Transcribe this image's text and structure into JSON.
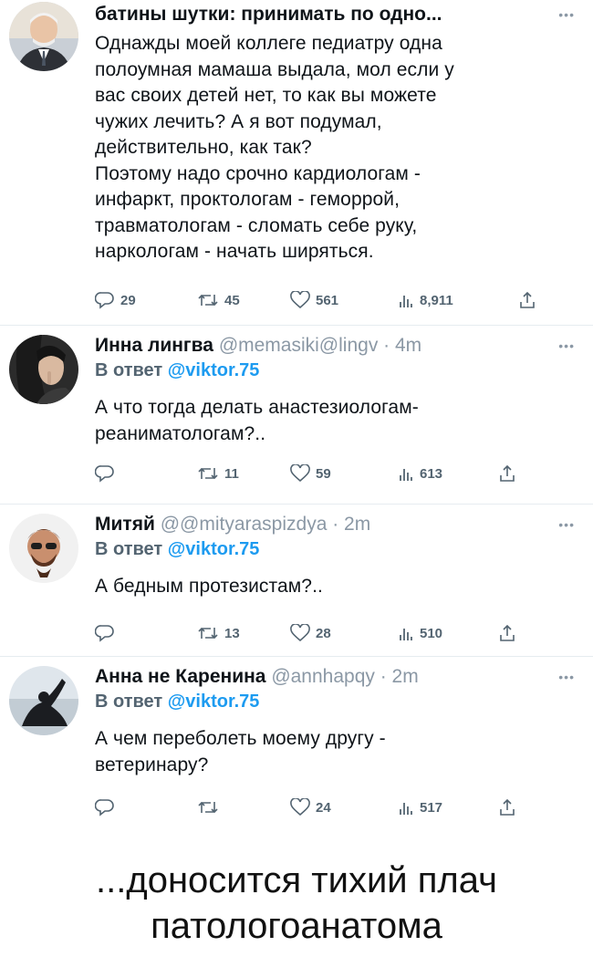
{
  "tweets": [
    {
      "name": "батины шутки: принимать по одно...",
      "handle": "",
      "time": "",
      "reply_label": "",
      "reply_user": "",
      "text": "Однажды моей коллеге педиатру одна\nполоумная мамаша выдала, мол если у\nвас своих детей нет, то как вы можете\nчужих лечить? А я вот подумал,\nдействительно, как так?\nПоэтому надо срочно кардиологам -\nинфаркт, проктологам - геморрой,\nтравматологам - сломать себе руку,\nнаркологам - начать ширяться.",
      "replies": "29",
      "retweets": "45",
      "likes": "561",
      "views": "8,911"
    },
    {
      "name": "Инна лингва",
      "handle": "@memasiki@lingv · 4m",
      "reply_label": "В ответ",
      "reply_user": "@viktor.75",
      "text": "А что тогда делать анастезиологам-\nреаниматологам?..",
      "replies": "",
      "retweets": "11",
      "likes": "59",
      "views": "613"
    },
    {
      "name": "Митяй",
      "handle": "@@mityaraspizdya · 2m",
      "reply_label": "В ответ",
      "reply_user": "@viktor.75",
      "text": "А бедным протезистам?..",
      "replies": "",
      "retweets": "13",
      "likes": "28",
      "views": "510"
    },
    {
      "name": "Анна не Каренина",
      "handle": "@annhapqy · 2m",
      "reply_label": "В ответ",
      "reply_user": "@viktor.75",
      "text": "А чем переболеть моему другу -\nветеринару?",
      "replies": "",
      "retweets": "",
      "likes": "24",
      "views": "517"
    }
  ],
  "caption": {
    "line1": "...доносится тихий плач",
    "line2": "патологоанатома"
  },
  "icons": {
    "reply": "reply-icon",
    "retweet": "retweet-icon",
    "like": "heart-icon",
    "views": "views-icon",
    "share": "share-icon",
    "more": "more-icon"
  },
  "colors": {
    "link": "#1d9bf0",
    "secondary_text": "#536471"
  }
}
